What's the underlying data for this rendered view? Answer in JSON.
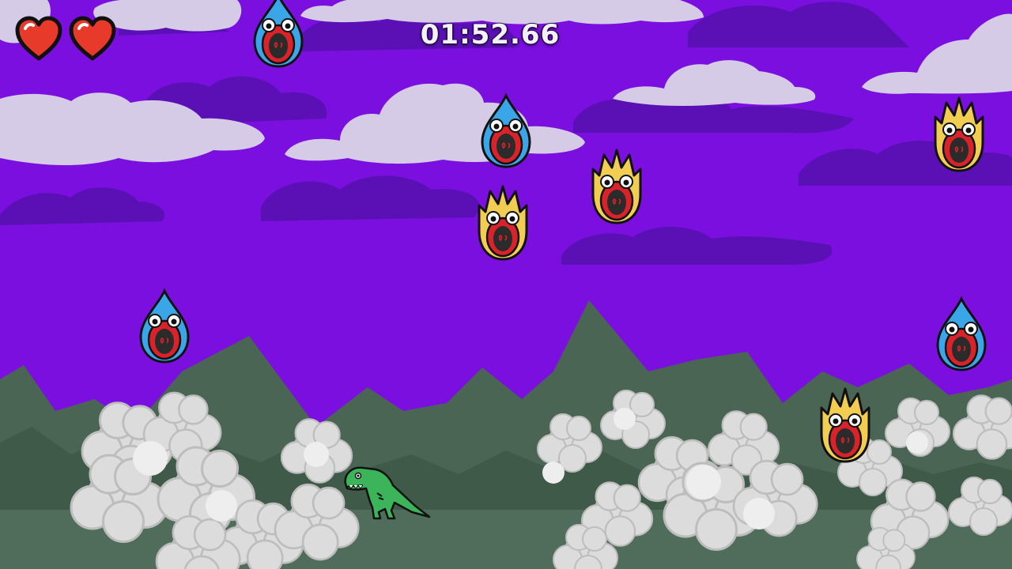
{
  "hud": {
    "timer": "01:52.66",
    "lives": {
      "current": 2,
      "max": 2
    }
  },
  "colors": {
    "sky": "#7a0fe0",
    "dark_cloud": "#5b10b6",
    "light_cloud": "#d5cbe6",
    "mountain": "#4b6554",
    "ground": "#4f6d5a",
    "dust": "#e4e4e4",
    "heart": "#e83a2a",
    "dino": "#3bb45a"
  },
  "entities": {
    "player": {
      "type": "trex",
      "icon": "trex-icon"
    },
    "enemies": [
      {
        "type": "water-drop"
      },
      {
        "type": "water-drop"
      },
      {
        "type": "fire-drop"
      },
      {
        "type": "fire-drop"
      },
      {
        "type": "fire-drop"
      },
      {
        "type": "water-drop"
      },
      {
        "type": "water-drop"
      },
      {
        "type": "fire-drop"
      }
    ]
  }
}
